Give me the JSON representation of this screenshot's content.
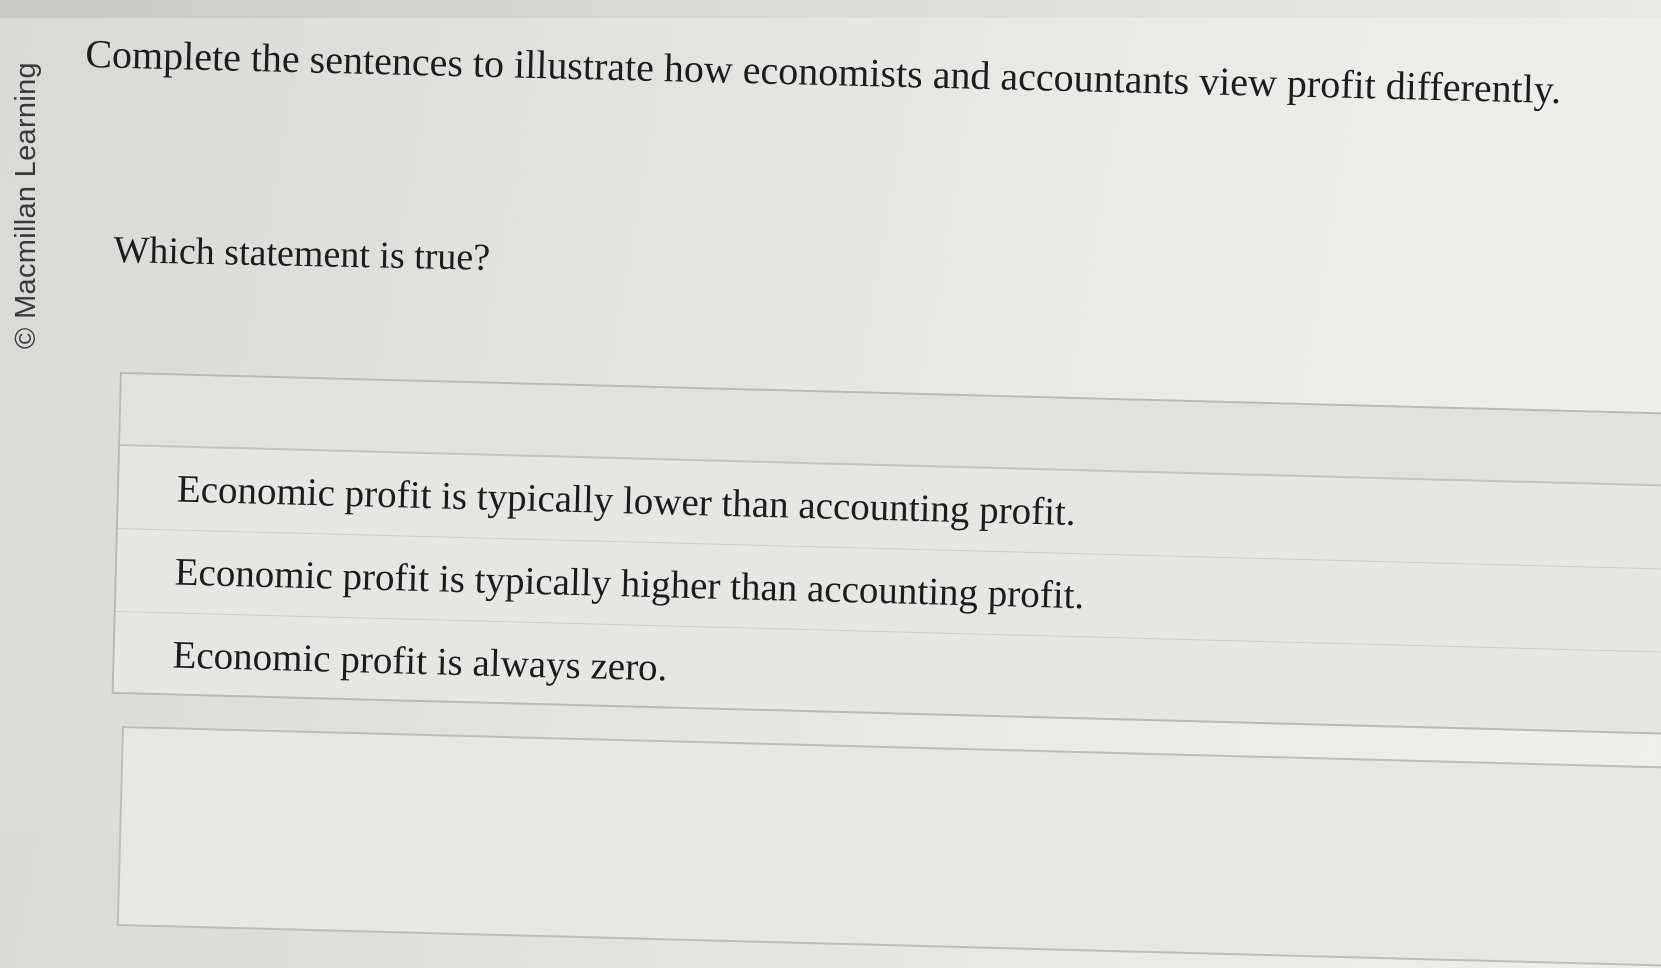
{
  "watermark": {
    "text": "© Macmillan Learning"
  },
  "question": {
    "text": "Complete the sentences to illustrate how economists and accountants view profit differently."
  },
  "prompt": {
    "text": "Which statement is true?"
  },
  "choices": [
    {
      "label": "Economic profit is typically lower than accounting profit."
    },
    {
      "label": "Economic profit is typically higher than accounting profit."
    },
    {
      "label": "Economic profit is always zero."
    }
  ]
}
